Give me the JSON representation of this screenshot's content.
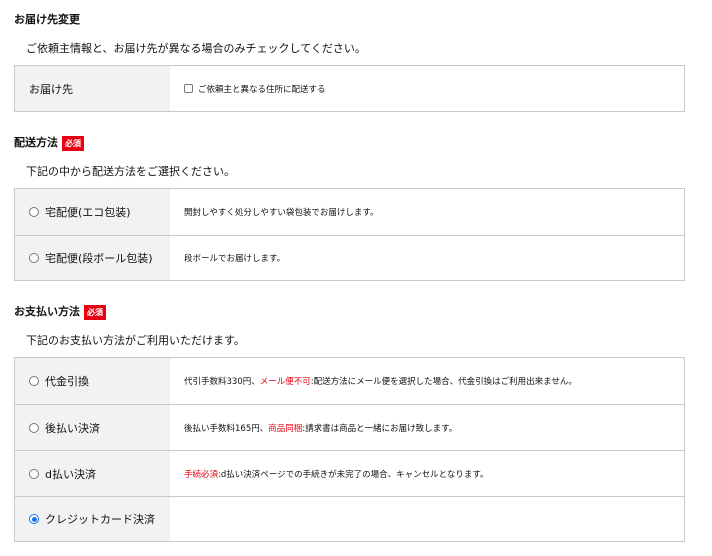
{
  "delivery_change": {
    "title": "お届け先変更",
    "description": "ご依頼主情報と、お届け先が異なる場合のみチェックしてください。",
    "row_label": "お届け先",
    "checkbox_label": "ご依頼主と異なる住所に配送する",
    "checked": false
  },
  "shipping": {
    "title": "配送方法",
    "required_badge": "必須",
    "description": "下記の中から配送方法をご選択ください。",
    "options": [
      {
        "label": "宅配便(エコ包装)",
        "detail": "開封しやすく処分しやすい袋包装でお届けします。",
        "selected": false
      },
      {
        "label": "宅配便(段ボール包装)",
        "detail": "段ボールでお届けします。",
        "selected": false
      }
    ]
  },
  "payment": {
    "title": "お支払い方法",
    "required_badge": "必須",
    "description": "下記のお支払い方法がご利用いただけます。",
    "options": [
      {
        "label": "代金引換",
        "detail_prefix": "代引手数料330円、",
        "detail_highlight": "メール便不可",
        "detail_suffix": ":配送方法にメール便を選択した場合、代金引換はご利用出来ません。",
        "selected": false
      },
      {
        "label": "後払い決済",
        "detail_prefix": "後払い手数料165円、",
        "detail_highlight": "商品同梱",
        "detail_suffix": ":請求書は商品と一緒にお届け致します。",
        "selected": false
      },
      {
        "label": "d払い決済",
        "detail_prefix": "",
        "detail_highlight": "手続必須",
        "detail_suffix": ":d払い決済ページでの手続きが未完了の場合、キャンセルとなります。",
        "selected": false
      },
      {
        "label": "クレジットカード決済",
        "detail_prefix": "",
        "detail_highlight": "",
        "detail_suffix": "",
        "selected": true
      }
    ]
  },
  "colors": {
    "accent": "#1a73e8",
    "required": "#e60012",
    "label_bg": "#f2f2f2",
    "border": "#c8c8c8"
  }
}
